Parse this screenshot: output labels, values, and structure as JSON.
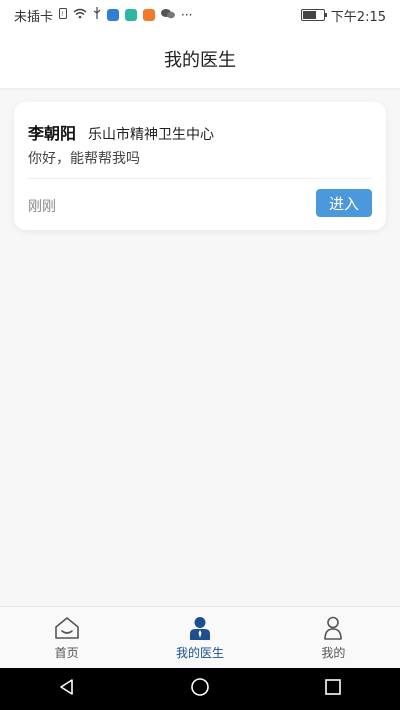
{
  "status_bar": {
    "carrier": "未插卡",
    "time": "下午2:15",
    "icons": [
      "sim-icon",
      "wifi-icon",
      "usb-icon",
      "app-icon-blue",
      "app-icon-teal",
      "app-icon-orange",
      "wechat-icon",
      "more-icon",
      "battery-icon"
    ]
  },
  "header": {
    "title": "我的医生"
  },
  "card": {
    "doctor_name": "李朝阳",
    "hospital": "乐山市精神卫生中心",
    "message": "你好，能帮帮我吗",
    "time": "刚刚",
    "enter_label": "进入",
    "enter_color": "#4b99dc"
  },
  "tabs": [
    {
      "label": "首页",
      "icon": "home-icon",
      "active": false
    },
    {
      "label": "我的医生",
      "icon": "doctor-icon",
      "active": true
    },
    {
      "label": "我的",
      "icon": "profile-icon",
      "active": false
    }
  ],
  "colors": {
    "accent": "#1d4f8f",
    "button": "#4b99dc"
  }
}
